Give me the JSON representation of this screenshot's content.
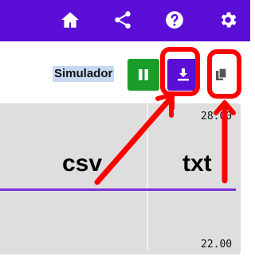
{
  "topbar": {
    "icons": [
      "home-icon",
      "share-icon",
      "help-icon",
      "settings-icon"
    ],
    "color": "#5b0ed6"
  },
  "toolbar": {
    "simulator_label": "Simulador",
    "pause_button_color": "#1a9c2b",
    "download_button_color": "#5b0ed6"
  },
  "chart": {
    "series_color": "#7a2fd8",
    "left_label": "csv",
    "right_label": "txt",
    "tick_top": "28.00",
    "tick_bottom": "22.00"
  },
  "annotation": {
    "color": "#ff0000"
  }
}
